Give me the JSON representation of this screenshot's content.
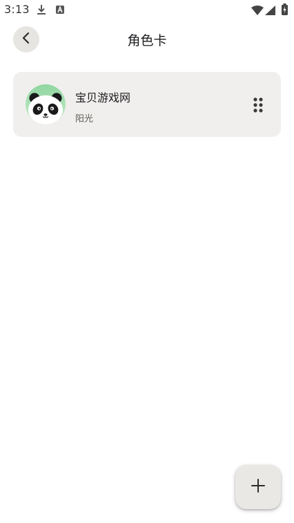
{
  "status_bar": {
    "time": "3:13",
    "icons": [
      "download-icon",
      "a-letter-icon",
      "wifi-icon",
      "signal-icon",
      "battery-icon"
    ]
  },
  "app_bar": {
    "back_icon": "chevron-left-icon",
    "title": "角色卡"
  },
  "cards": [
    {
      "title": "宝贝游戏网",
      "subtitle": "阳光",
      "avatar": "panda-avatar",
      "handle_icon": "drag-handle-icon"
    }
  ],
  "fab": {
    "icon": "plus-icon"
  },
  "colors": {
    "background": "#ffffff",
    "card": "#f0efed",
    "button_bg": "#e7e5e2",
    "fab_bg": "#eae8e5",
    "text_primary": "#1c1b1f",
    "text_secondary": "#5f5b57"
  }
}
